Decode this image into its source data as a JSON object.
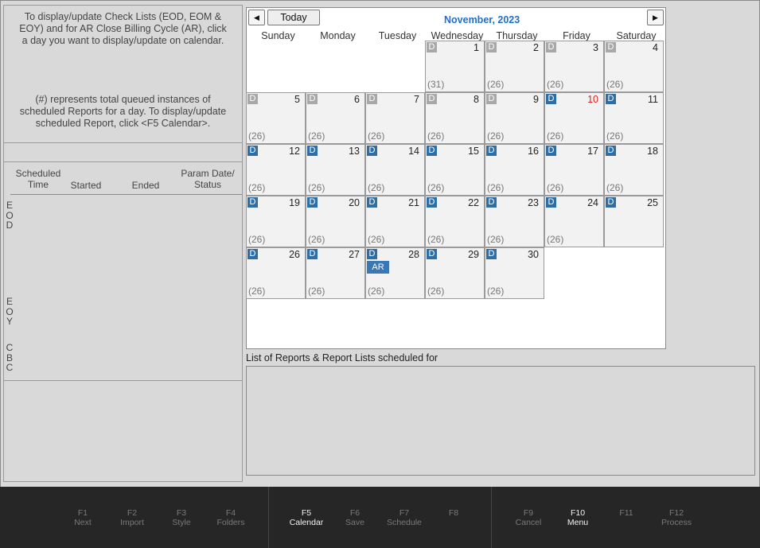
{
  "left_panel": {
    "info_top": "To display/update Check Lists (EOD, EOM &\nEOY) and for AR Close Billing Cycle (AR), click\na day you want to display/update on calendar.",
    "info_bottom": "(#) represents total queued instances of\nscheduled Reports for a day.  To display/update\nscheduled Report, click <F5 Calendar>.",
    "columns": {
      "scheduled_time": "Scheduled\nTime",
      "started": "Started",
      "ended": "Ended",
      "param_status": "Param Date/\nStatus"
    },
    "section_labels": [
      "EOD",
      "EOY",
      "CBC"
    ]
  },
  "calendar": {
    "prev_icon": "left-triangle-icon",
    "next_icon": "right-triangle-icon",
    "today_label": "Today",
    "month_title": "November, 2023",
    "accent_color": "#1f6fd1",
    "badge_active_color": "#2e6ea6",
    "badge_past_color": "#a8a8a8",
    "weekdays": [
      "Sunday",
      "Monday",
      "Tuesday",
      "Wednesday",
      "Thursday",
      "Friday",
      "Saturday"
    ],
    "days": [
      {
        "day": "1",
        "badge": "D",
        "state": "past",
        "count": "(31)"
      },
      {
        "day": "2",
        "badge": "D",
        "state": "past",
        "count": "(26)"
      },
      {
        "day": "3",
        "badge": "D",
        "state": "past",
        "count": "(26)"
      },
      {
        "day": "4",
        "badge": "D",
        "state": "past",
        "count": "(26)"
      },
      {
        "day": "5",
        "badge": "D",
        "state": "past",
        "count": "(26)"
      },
      {
        "day": "6",
        "badge": "D",
        "state": "past",
        "count": "(26)"
      },
      {
        "day": "7",
        "badge": "D",
        "state": "past",
        "count": "(26)"
      },
      {
        "day": "8",
        "badge": "D",
        "state": "past",
        "count": "(26)"
      },
      {
        "day": "9",
        "badge": "D",
        "state": "past",
        "count": "(26)"
      },
      {
        "day": "10",
        "badge": "D",
        "state": "active",
        "count": "(26)",
        "today": true
      },
      {
        "day": "11",
        "badge": "D",
        "state": "active",
        "count": "(26)"
      },
      {
        "day": "12",
        "badge": "D",
        "state": "active",
        "count": "(26)"
      },
      {
        "day": "13",
        "badge": "D",
        "state": "active",
        "count": "(26)"
      },
      {
        "day": "14",
        "badge": "D",
        "state": "active",
        "count": "(26)"
      },
      {
        "day": "15",
        "badge": "D",
        "state": "active",
        "count": "(26)"
      },
      {
        "day": "16",
        "badge": "D",
        "state": "active",
        "count": "(26)"
      },
      {
        "day": "17",
        "badge": "D",
        "state": "active",
        "count": "(26)"
      },
      {
        "day": "18",
        "badge": "D",
        "state": "active",
        "count": "(26)"
      },
      {
        "day": "19",
        "badge": "D",
        "state": "active",
        "count": "(26)"
      },
      {
        "day": "20",
        "badge": "D",
        "state": "active",
        "count": "(26)"
      },
      {
        "day": "21",
        "badge": "D",
        "state": "active",
        "count": "(26)"
      },
      {
        "day": "22",
        "badge": "D",
        "state": "active",
        "count": "(26)"
      },
      {
        "day": "23",
        "badge": "D",
        "state": "active",
        "count": "(26)"
      },
      {
        "day": "24",
        "badge": "D",
        "state": "active",
        "count": "(26)"
      },
      {
        "day": "25",
        "badge": "D",
        "state": "active",
        "count": ""
      },
      {
        "day": "26",
        "badge": "D",
        "state": "active",
        "count": "(26)"
      },
      {
        "day": "27",
        "badge": "D",
        "state": "active",
        "count": "(26)"
      },
      {
        "day": "28",
        "badge": "D",
        "state": "active",
        "count": "(26)",
        "extra": "AR"
      },
      {
        "day": "29",
        "badge": "D",
        "state": "active",
        "count": "(26)"
      },
      {
        "day": "30",
        "badge": "D",
        "state": "active",
        "count": "(26)"
      }
    ]
  },
  "reports": {
    "label": "List of Reports & Report Lists scheduled for"
  },
  "function_keys": [
    {
      "key": "F1",
      "label": "Next",
      "enabled": false
    },
    {
      "key": "F2",
      "label": "Import",
      "enabled": false
    },
    {
      "key": "F3",
      "label": "Style",
      "enabled": false
    },
    {
      "key": "F4",
      "label": "Folders",
      "enabled": false
    },
    {
      "key": "F5",
      "label": "Calendar",
      "enabled": true
    },
    {
      "key": "F6",
      "label": "Save",
      "enabled": false
    },
    {
      "key": "F7",
      "label": "Schedule",
      "enabled": false
    },
    {
      "key": "F8",
      "label": "",
      "enabled": false
    },
    {
      "key": "F9",
      "label": "Cancel",
      "enabled": false
    },
    {
      "key": "F10",
      "label": "Menu",
      "enabled": true
    },
    {
      "key": "F11",
      "label": "",
      "enabled": false
    },
    {
      "key": "F12",
      "label": "Process",
      "enabled": false
    }
  ]
}
